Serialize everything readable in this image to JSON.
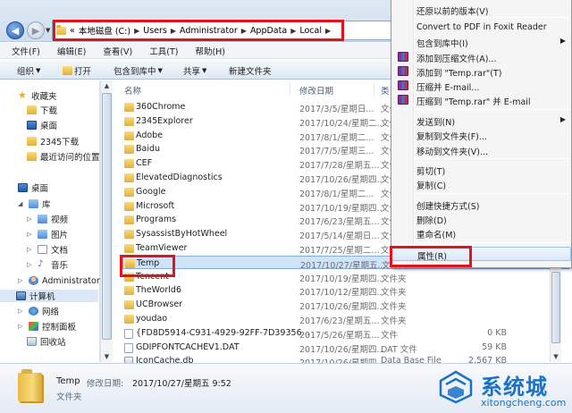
{
  "address": {
    "segments": [
      "«",
      "本地磁盘 (C:)",
      "Users",
      "Administrator",
      "AppData",
      "Local"
    ]
  },
  "menubar": {
    "items": [
      "文件(F)",
      "编辑(E)",
      "查看(V)",
      "工具(T)",
      "帮助(H)"
    ]
  },
  "toolbar": {
    "organize": "组织",
    "open": "打开",
    "include": "包含到库中",
    "share": "共享",
    "new_folder": "新建文件夹"
  },
  "navpane": {
    "favorites": "收藏夹",
    "downloads": "下载",
    "desktop": "桌面",
    "dl2345": "2345下载",
    "recent": "最近访问的位置",
    "desktop2": "桌面",
    "libraries": "库",
    "videos": "视频",
    "pictures": "图片",
    "documents": "文档",
    "music": "音乐",
    "admin": "Administrator",
    "computer": "计算机",
    "network": "网络",
    "control_panel": "控制面板",
    "recycle": "回收站"
  },
  "columns": {
    "name": "名称",
    "date": "修改日期",
    "type": "类"
  },
  "files": [
    {
      "name": "360Chrome",
      "date": "2017/3/5/星期日...",
      "type": "文件夹",
      "size": "",
      "icon": "folder"
    },
    {
      "name": "2345Explorer",
      "date": "2017/10/24/星期二...",
      "type": "文件夹",
      "size": "",
      "icon": "folder"
    },
    {
      "name": "Adobe",
      "date": "2017/8/1/星期二...",
      "type": "文件夹",
      "size": "",
      "icon": "folder"
    },
    {
      "name": "Baidu",
      "date": "2017/7/5/星期三...",
      "type": "文件夹",
      "size": "",
      "icon": "folder"
    },
    {
      "name": "CEF",
      "date": "2017/7/28/星期五...",
      "type": "文件夹",
      "size": "",
      "icon": "folder"
    },
    {
      "name": "ElevatedDiagnostics",
      "date": "2017/10/26/星期四...",
      "type": "文件夹",
      "size": "",
      "icon": "folder"
    },
    {
      "name": "Google",
      "date": "2017/8/1/星期二...",
      "type": "文件夹",
      "size": "",
      "icon": "folder"
    },
    {
      "name": "Microsoft",
      "date": "2017/10/19/星期四...",
      "type": "文件夹",
      "size": "",
      "icon": "folder"
    },
    {
      "name": "Programs",
      "date": "2017/6/23/星期五...",
      "type": "文件夹",
      "size": "",
      "icon": "folder"
    },
    {
      "name": "SysassistByHotWheel",
      "date": "2017/5/14/星期日...",
      "type": "文件夹",
      "size": "",
      "icon": "folder"
    },
    {
      "name": "TeamViewer",
      "date": "2017/7/25/星期二...",
      "type": "文件夹",
      "size": "",
      "icon": "folder"
    },
    {
      "name": "Temp",
      "date": "2017/10/27/星期五...",
      "type": "文件夹",
      "size": "",
      "icon": "folder"
    },
    {
      "name": "Tencent",
      "date": "2017/10/19/星期四...",
      "type": "文件夹",
      "size": "",
      "icon": "folder"
    },
    {
      "name": "TheWorld6",
      "date": "2017/10/12/星期四...",
      "type": "文件夹",
      "size": "",
      "icon": "folder"
    },
    {
      "name": "UCBrowser",
      "date": "2017/10/26/星期四...",
      "type": "文件夹",
      "size": "",
      "icon": "folder"
    },
    {
      "name": "youdao",
      "date": "2017/6/23/星期五...",
      "type": "文件夹",
      "size": "",
      "icon": "folder"
    },
    {
      "name": "{FD8D5914-C931-4929-92FF-7D39356...",
      "date": "2017/5/26/星期五...",
      "type": "文件",
      "size": "0 KB",
      "icon": "file"
    },
    {
      "name": "GDIPFONTCACHEV1.DAT",
      "date": "2017/10/26/星期四...",
      "type": "DAT 文件",
      "size": "59 KB",
      "icon": "file"
    },
    {
      "name": "IconCache.db",
      "date": "2017/10/26/星期四...",
      "type": "Data Base File",
      "size": "2,567 KB",
      "icon": "db"
    }
  ],
  "details": {
    "name": "Temp",
    "date_label": "修改日期:",
    "date_value": "2017/10/27/星期五 9:52",
    "type": "文件夹"
  },
  "context_menu": {
    "items": [
      {
        "label": "还原以前的版本(V)",
        "submenu": false,
        "icon": ""
      },
      {
        "label": "Convert to PDF in Foxit Reader",
        "submenu": false,
        "icon": ""
      },
      {
        "label": "包含到库中(I)",
        "submenu": true,
        "icon": ""
      },
      {
        "label": "添加到压缩文件(A)...",
        "submenu": false,
        "icon": "winrar"
      },
      {
        "label": "添加到 \"Temp.rar\"(T)",
        "submenu": false,
        "icon": "winrar"
      },
      {
        "label": "压缩并 E-mail...",
        "submenu": false,
        "icon": "winrar"
      },
      {
        "label": "压缩到 \"Temp.rar\" 并 E-mail",
        "submenu": false,
        "icon": "winrar"
      },
      {
        "label": "发送到(N)",
        "submenu": true,
        "icon": ""
      },
      {
        "label": "复制到文件夹(F)...",
        "submenu": false,
        "icon": ""
      },
      {
        "label": "移动到文件夹(V)...",
        "submenu": false,
        "icon": ""
      },
      {
        "label": "剪切(T)",
        "submenu": false,
        "icon": ""
      },
      {
        "label": "复制(C)",
        "submenu": false,
        "icon": ""
      },
      {
        "label": "创建快捷方式(S)",
        "submenu": false,
        "icon": ""
      },
      {
        "label": "删除(D)",
        "submenu": false,
        "icon": ""
      },
      {
        "label": "重命名(M)",
        "submenu": false,
        "icon": ""
      },
      {
        "label": "属性(R)",
        "submenu": false,
        "icon": ""
      }
    ]
  },
  "watermark": {
    "main": "系统城",
    "sub": "xitongcheng.com"
  },
  "colors": {
    "highlight_red": "#e0141c",
    "accent_blue": "#1a72c7"
  }
}
